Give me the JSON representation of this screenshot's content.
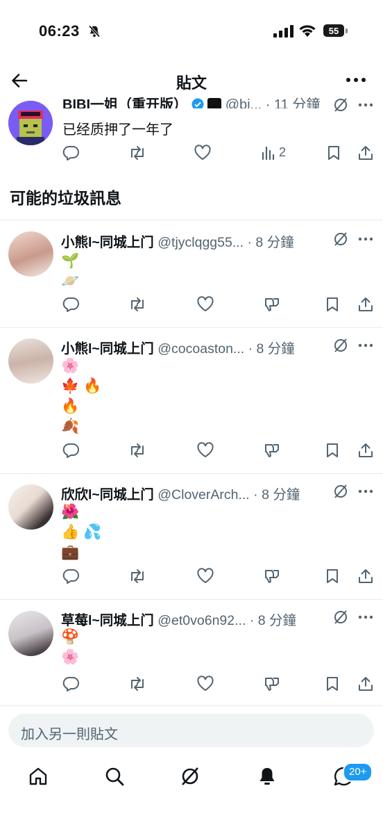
{
  "status_bar": {
    "time": "06:23",
    "battery": "55"
  },
  "nav": {
    "title": "貼文"
  },
  "parent_tweet": {
    "name": "BIBI一姐（重开版）",
    "handle": "@bi...",
    "time": "· 11 分鐘",
    "text": "已经质押了一年了",
    "views": "2"
  },
  "section_title": "可能的垃圾訊息",
  "posts": [
    {
      "name": "小熊l~同城上门",
      "handle": "@tjyclqgg55...",
      "time": "· 8 分鐘",
      "emojis": [
        "🌱",
        "🪐"
      ]
    },
    {
      "name": "小熊l~同城上门",
      "handle": "@cocoaston...",
      "time": "· 8 分鐘",
      "emojis": [
        "🌸",
        "🍁 🔥",
        "🔥",
        "🍂"
      ]
    },
    {
      "name": "欣欣l~同城上门",
      "handle": "@CloverArch...",
      "time": "· 8 分鐘",
      "emojis": [
        "🌺",
        "👍 💦",
        "💼"
      ]
    },
    {
      "name": "草莓l~同城上门",
      "handle": "@et0vo6n92...",
      "time": "· 8 分鐘",
      "emojis": [
        "🍄",
        "🌸"
      ]
    }
  ],
  "reply": {
    "placeholder": "加入另一則貼文"
  },
  "tabbar": {
    "badge": "20+"
  },
  "colors": {
    "accent": "#1d9bf0",
    "text": "#0f1419",
    "muted": "#536471",
    "divider": "#e6ecf0"
  }
}
